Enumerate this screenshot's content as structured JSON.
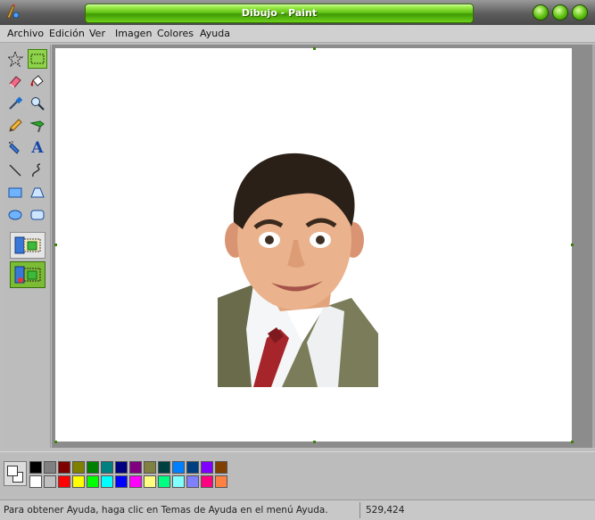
{
  "window": {
    "title": "Dibujo - Paint",
    "controls": [
      "minimize-icon",
      "maximize-icon",
      "close-icon"
    ]
  },
  "menu": [
    "Archivo",
    "Edición",
    "Ver",
    "Imagen",
    "Colores",
    "Ayuda"
  ],
  "tools": [
    {
      "name": "free-select",
      "icon": "star-select-icon"
    },
    {
      "name": "rect-select",
      "icon": "rect-select-icon",
      "selected": true
    },
    {
      "name": "eraser",
      "icon": "eraser-icon"
    },
    {
      "name": "fill",
      "icon": "paint-bucket-icon"
    },
    {
      "name": "pick-color",
      "icon": "eyedropper-icon"
    },
    {
      "name": "magnifier",
      "icon": "magnifier-icon"
    },
    {
      "name": "pencil",
      "icon": "pencil-icon"
    },
    {
      "name": "brush",
      "icon": "brush-icon"
    },
    {
      "name": "airbrush",
      "icon": "airbrush-icon"
    },
    {
      "name": "text",
      "icon": "text-icon",
      "label": "A"
    },
    {
      "name": "line",
      "icon": "line-icon"
    },
    {
      "name": "curve",
      "icon": "curve-icon"
    },
    {
      "name": "rectangle",
      "icon": "rectangle-icon"
    },
    {
      "name": "polygon",
      "icon": "polygon-icon"
    },
    {
      "name": "ellipse",
      "icon": "ellipse-icon"
    },
    {
      "name": "rounded-rect",
      "icon": "rounded-rectangle-icon"
    }
  ],
  "tool_options": [
    "opaque-selection-icon",
    "transparent-selection-icon"
  ],
  "colors": {
    "accent": "#63c414",
    "foreground": "#ffffff",
    "background": "#ffffff",
    "palette_top": [
      "#000000",
      "#808080",
      "#800000",
      "#808000",
      "#008000",
      "#008080",
      "#000080",
      "#800080",
      "#808040",
      "#004040",
      "#0080ff",
      "#004080",
      "#8000ff",
      "#804000"
    ],
    "palette_bottom": [
      "#ffffff",
      "#c0c0c0",
      "#ff0000",
      "#ffff00",
      "#00ff00",
      "#00ffff",
      "#0000ff",
      "#ff00ff",
      "#ffff80",
      "#00ff80",
      "#80ffff",
      "#8080ff",
      "#ff0080",
      "#ff8040"
    ]
  },
  "status": {
    "help": "Para obtener Ayuda, haga clic en Temas de Ayuda en el menú Ayuda.",
    "coords": "529,424"
  }
}
